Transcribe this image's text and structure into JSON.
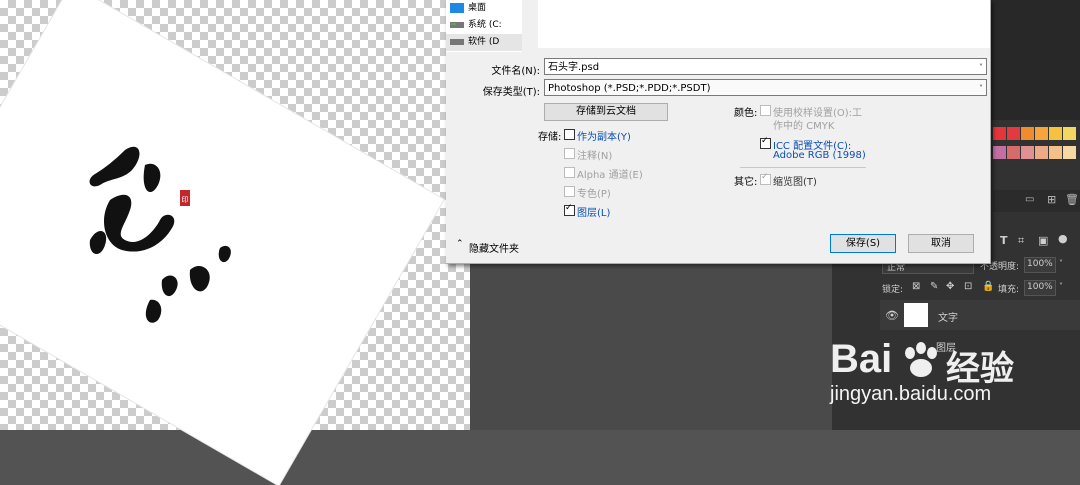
{
  "tree": {
    "items": [
      {
        "label": "桌面",
        "icon": "desktop-icon"
      },
      {
        "label": "系统 (C:",
        "icon": "drive-icon"
      },
      {
        "label": "软件 (D",
        "icon": "drive-icon"
      }
    ],
    "chevron": "˅"
  },
  "form": {
    "filename_label": "文件名(N):",
    "filename_value": "石头字.psd",
    "type_label": "保存类型(T):",
    "type_value": "Photoshop (*.PSD;*.PDD;*.PSDT)",
    "cloud_button": "存储到云文档"
  },
  "storage": {
    "label": "存储:",
    "options": [
      {
        "label": "作为副本(Y)",
        "checked": false,
        "enabled": true
      },
      {
        "label": "注释(N)",
        "checked": false,
        "enabled": false
      },
      {
        "label": "Alpha 通道(E)",
        "checked": false,
        "enabled": false
      },
      {
        "label": "专色(P)",
        "checked": false,
        "enabled": false
      },
      {
        "label": "图层(L)",
        "checked": true,
        "enabled": true
      }
    ]
  },
  "color": {
    "label": "颜色:",
    "proof_line1": "使用校样设置(O):",
    "proof_line1b": "工",
    "proof_line2": "作中的 CMYK",
    "icc_line1": "ICC 配置文件(C):",
    "icc_line2": "Adobe RGB (1998)"
  },
  "other": {
    "label": "其它:",
    "thumbnail": "缩览图(T)"
  },
  "footer": {
    "hide_folders": "隐藏文件夹",
    "save": "保存(S)",
    "cancel": "取消"
  },
  "layers": {
    "blend_mode": "正常",
    "opacity_label": "不透明度:",
    "opacity_value": "100%",
    "lock_label": "锁定:",
    "fill_label": "填充:",
    "fill_value": "100%",
    "layer1": "文字",
    "layer2": "图层"
  },
  "watermark": {
    "brand": "Bai",
    "brand2": "经验",
    "url": "jingyan.baidu.com"
  },
  "canvas": {
    "stamp": "印"
  },
  "colors": {
    "swatches": [
      "#e5343a",
      "#e23a3f",
      "#f08c2e",
      "#f5a53b",
      "#f4c23e",
      "#f2d860",
      "#c36fa3",
      "#d66b6b",
      "#e39090",
      "#ecaa86",
      "#f3c089",
      "#f6d8a4"
    ]
  }
}
